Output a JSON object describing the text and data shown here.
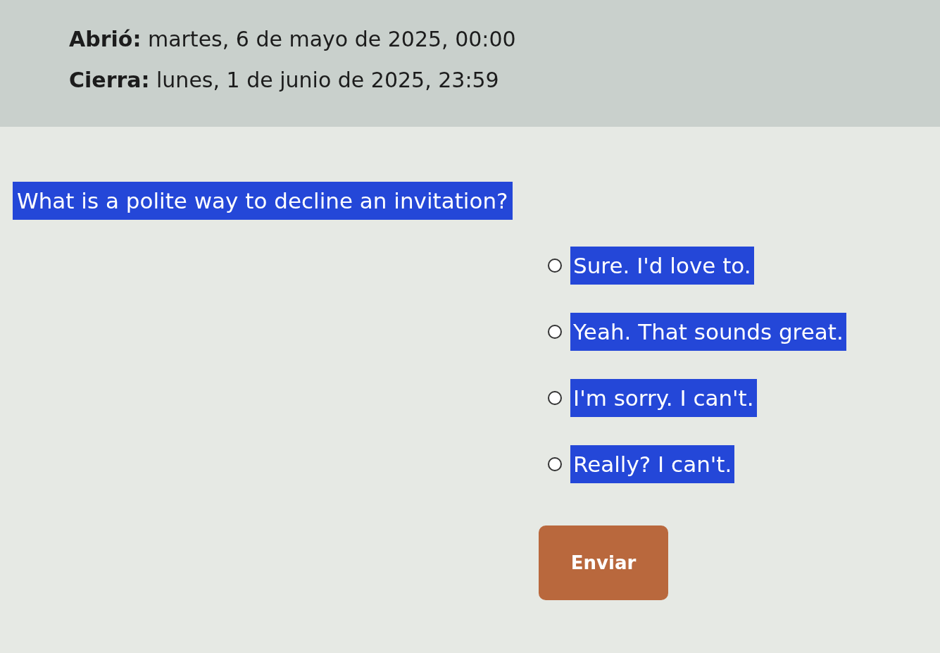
{
  "dates": [
    {
      "text": "**Abrió:** martes, 6 de mayo de 2025, 00:00"
    },
    {
      "text": "**Cierra:** lunes, 1 de junio de 2025, 23:59"
    }
  ],
  "question": "What is a polite way to decline an invitation?",
  "options": [
    {
      "label": "Sure. I'd love to.",
      "selected": false
    },
    {
      "label": "Yeah. That sounds great.",
      "selected": false
    },
    {
      "label": "I'm sorry. I can't.",
      "selected": false
    },
    {
      "label": "Really? I can't.",
      "selected": false
    }
  ],
  "submit_button": "Enviar"
}
